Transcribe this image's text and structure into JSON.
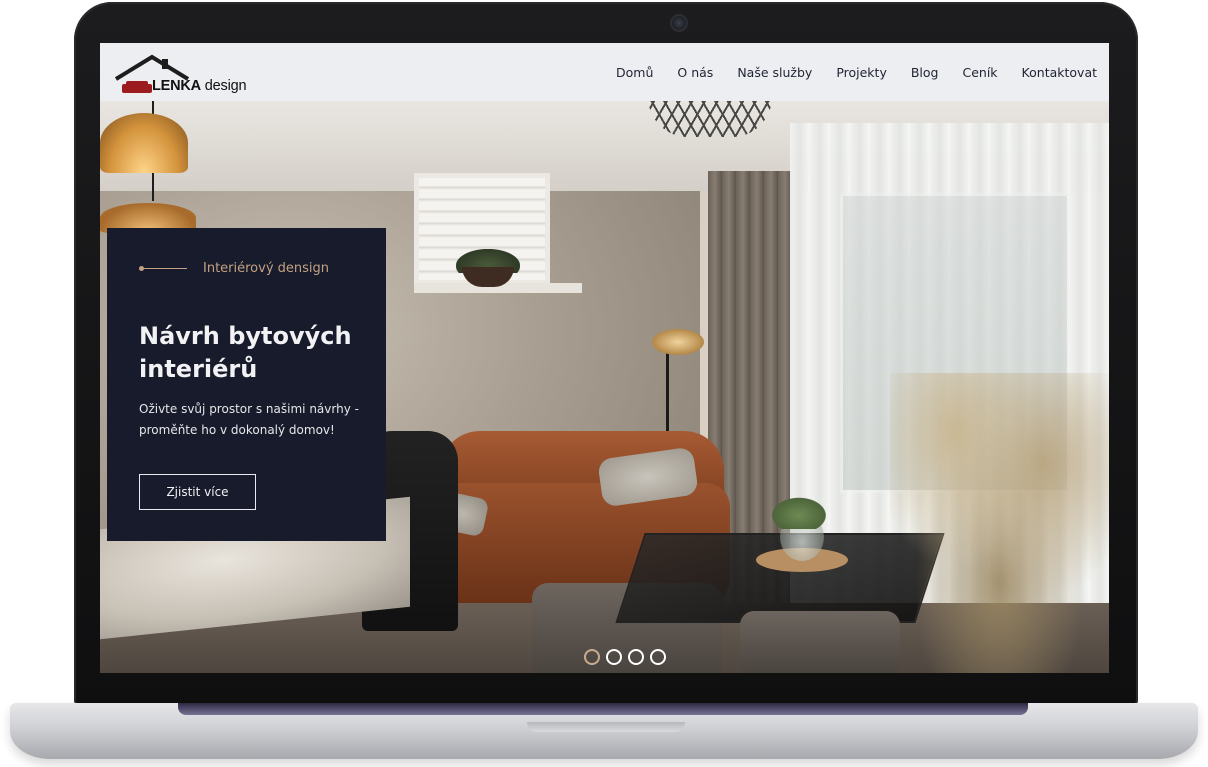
{
  "logo": {
    "brand": "LENKA",
    "suffix": "design",
    "icon": "house-sofa-logo-icon",
    "roof_color": "#1d1d1d",
    "sofa_color": "#9b1b1f"
  },
  "nav": {
    "items": [
      {
        "label": "Domů"
      },
      {
        "label": "O nás"
      },
      {
        "label": "Naše služby"
      },
      {
        "label": "Projekty"
      },
      {
        "label": "Blog"
      },
      {
        "label": "Ceník"
      },
      {
        "label": "Kontaktovat"
      }
    ]
  },
  "hero": {
    "eyebrow": "Interiérový densign",
    "title": "Návrh bytových interiérů",
    "subtitle": "Oživte svůj prostor s našimi návrhy - proměňte ho v dokonalý domov!",
    "button_label": "Zjistit více",
    "card_color": "#171b2b",
    "accent_color": "#c2a184"
  },
  "carousel": {
    "slide_count": 4,
    "active_index": 0
  }
}
